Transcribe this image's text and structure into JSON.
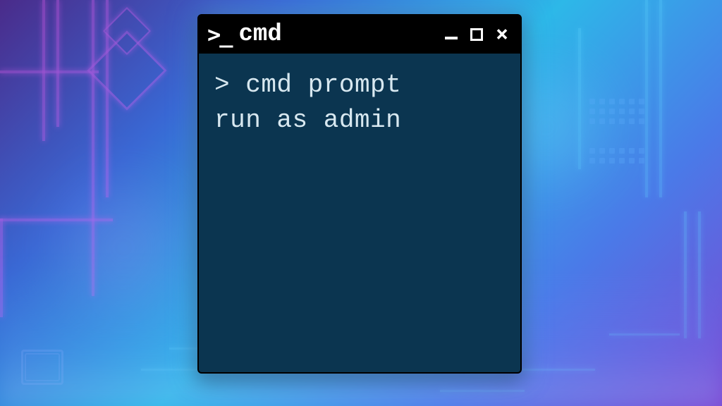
{
  "terminal": {
    "title_icon": ">_",
    "title": "cmd",
    "prompt_symbol": ">",
    "command_line1": "cmd prompt",
    "command_line2": "run as admin"
  },
  "window_controls": {
    "minimize": "minimize",
    "maximize": "maximize",
    "close": "close"
  }
}
